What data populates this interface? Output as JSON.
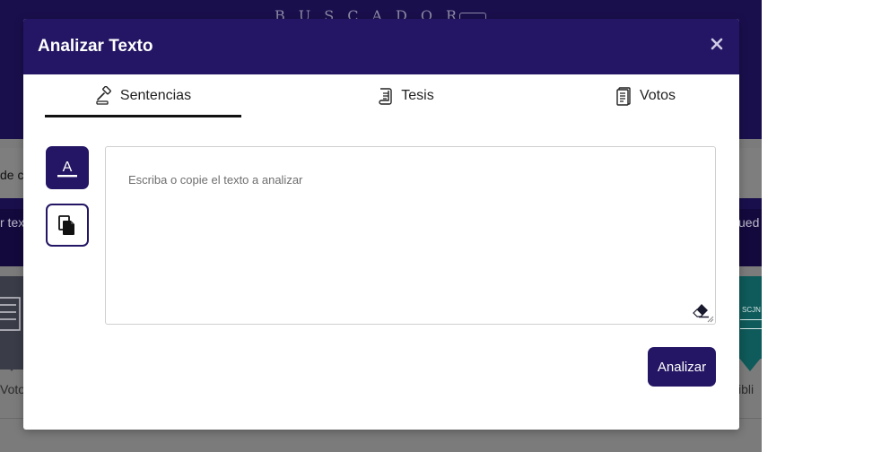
{
  "background": {
    "header_title": "BUSCADOR",
    "fragment_left_1": "de c",
    "fragment_left_2": "r tex",
    "fragment_right_2": "ued",
    "card_left_label": "Voto",
    "card_right_label": "ibli",
    "card_right_badge": "SCJN"
  },
  "modal": {
    "title": "Analizar Texto",
    "close_icon": "close-icon",
    "tabs": [
      {
        "label": "Sentencias",
        "icon": "gavel-icon",
        "active": true
      },
      {
        "label": "Tesis",
        "icon": "scroll-icon",
        "active": false
      },
      {
        "label": "Votos",
        "icon": "document-icon",
        "active": false
      }
    ],
    "tools": [
      {
        "name": "text-format",
        "icon": "text-format-icon",
        "label": "A"
      },
      {
        "name": "paste",
        "icon": "paste-file-icon"
      }
    ],
    "textarea": {
      "placeholder": "Escriba o copie el texto a analizar",
      "value": ""
    },
    "eraser_icon": "eraser-icon",
    "analyze_button": "Analizar"
  },
  "colors": {
    "primary": "#241664",
    "header_bg": "#1a0f4d",
    "overlay_gray": "#7b7b7b"
  }
}
